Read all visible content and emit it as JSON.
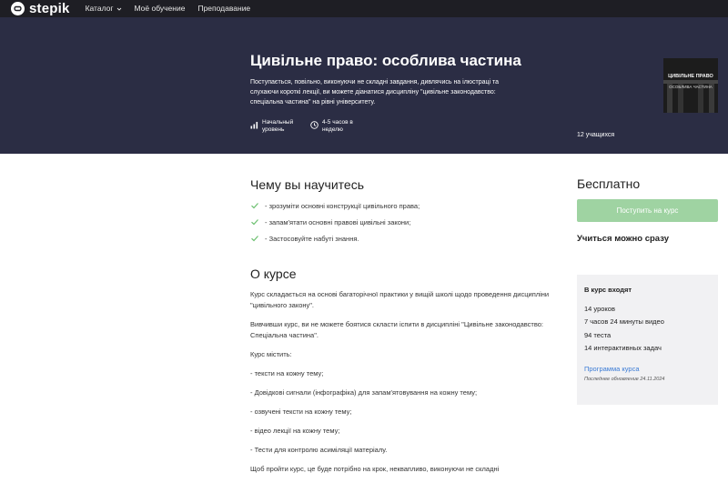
{
  "nav": {
    "logo_text": "stepik",
    "catalog": "Каталог",
    "my_learning": "Моё обучение",
    "teaching": "Преподавание"
  },
  "hero": {
    "title": "Цивільне право: особлива частина",
    "description": "Поступається, повільно, виконуючи не складні завдання, дивлячись на ілюстраці та слухаючи короткі лекції, ви можете діанатися дисципліну \"цивільне законодавство: спеціальна частина\" на рівні університету.",
    "level": "Начальный уровень",
    "time": "4-5 часов в неделю",
    "learners": "12 учащихся",
    "cover": {
      "title": "ЦИВІЛЬНЕ ПРАВО",
      "subtitle": "ОСОБЛИВА ЧАСТИНА"
    }
  },
  "learn": {
    "heading": "Чему вы научитесь",
    "items": [
      "- зрозуміти основні конструкції цивільного права;",
      "- запам'ятати основні правові цивільні закони;",
      "- Застосовуйте набуті знання."
    ]
  },
  "about": {
    "heading": "О курсе",
    "paragraphs": [
      "Курс складається на основі багаторічної практики у вищій школі щодо проведення дисципліни \"цивільного закону\".",
      "Вивчивши курс, ви не можете боятися скласти іспити в дисципліні \"Цивільне законодавство: Спеціальна частина\".",
      "Курс містить:",
      "- тексти на кожну тему;",
      "- Довідкові сигнали (інфографіка) для запам'ятовування на кожну тему;",
      "- озвучені тексти на кожну тему;",
      "- відео лекції на кожну тему;",
      "- Тести для контролю асиміляції матеріалу.",
      "Щоб пройти курс, це буде потрібно на крок, неквапливо, виконуючи не складні"
    ]
  },
  "sidebar": {
    "price": "Бесплатно",
    "enroll_button": "Поступить на курс",
    "start_now": "Учиться можно сразу",
    "includes_title": "В курс входят",
    "includes": [
      "14 уроков",
      "7 часов 24 минуты видео",
      "94 теста",
      "14 интерактивных задач"
    ],
    "program_link": "Программа курса",
    "last_updated": "Последнее обновление 24.11.2024"
  },
  "colors": {
    "nav_bg": "#1e1e24",
    "hero_bg": "#2b2d44",
    "accent_green": "#9fd3a2",
    "check_green": "#6cc070",
    "link_blue": "#3a7bd5"
  }
}
